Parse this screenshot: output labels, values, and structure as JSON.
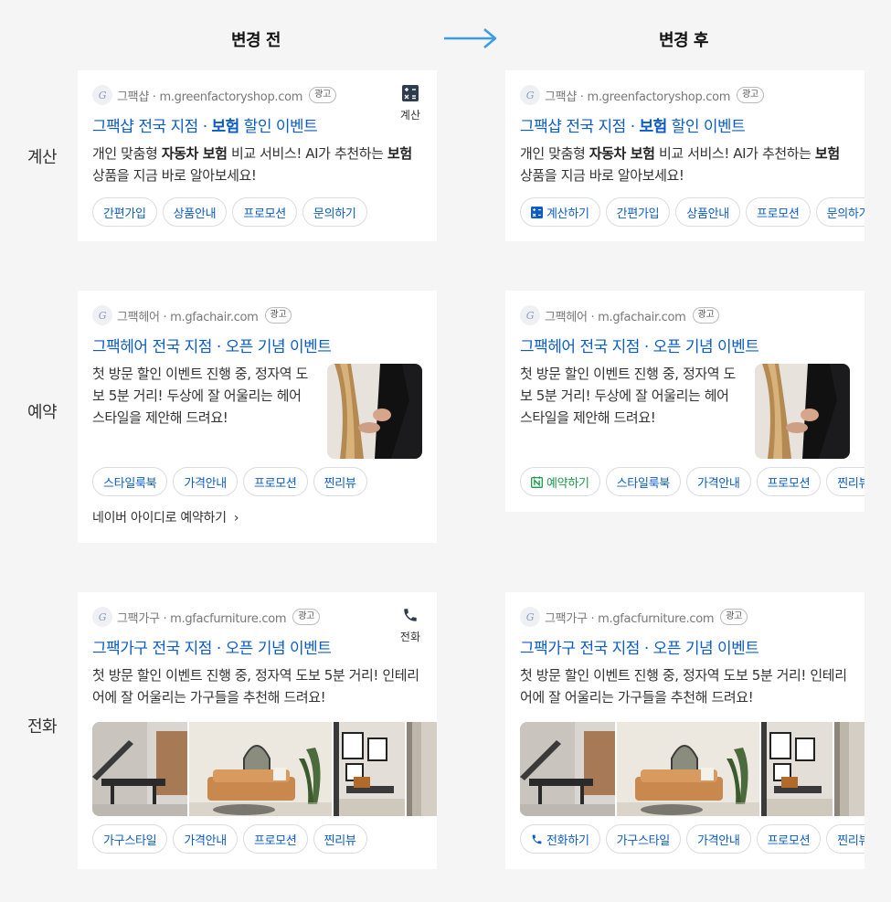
{
  "headers": {
    "before": "변경 전",
    "after": "변경 후"
  },
  "rows": {
    "calc": "계산",
    "reserve": "예약",
    "phone": "전화"
  },
  "ad_badge": "광고",
  "favicon_letter": "G",
  "calc_card": {
    "source": "그팩샵 · m.greenfactoryshop.com",
    "title_pre": "그팩샵 전국 지점 · ",
    "title_bold": "보험",
    "title_post": " 할인 이벤트",
    "desc_1": "개인 맞춤형 ",
    "desc_bold1": "자동차 보험",
    "desc_2": " 비교 서비스! AI가 추천하는 ",
    "desc_bold2": "보험",
    "desc_3": " 상품을 지금 바로 알아보세요!",
    "side_label": "계산",
    "chips_before": [
      "간편가입",
      "상품안내",
      "프로모션",
      "문의하기"
    ],
    "action_chip": "계산하기",
    "chips_after": [
      "간편가입",
      "상품안내",
      "프로모션",
      "문의하기"
    ]
  },
  "reserve_card": {
    "source": "그팩헤어 · m.gfachair.com",
    "title": "그팩헤어 전국 지점 · 오픈 기념 이벤트",
    "desc": "첫 방문 할인 이벤트 진행 중, 정자역 도보 5분 거리! 두상에 잘 어울리는 헤어 스타일을 제안해 드려요!",
    "chips_before": [
      "스타일룩북",
      "가격안내",
      "프로모션",
      "찐리뷰"
    ],
    "naver_link": "네이버 아이디로 예약하기",
    "action_chip": "예약하기",
    "chips_after": [
      "스타일룩북",
      "가격안내",
      "프로모션",
      "찐리뷰"
    ]
  },
  "phone_card": {
    "source": "그팩가구 · m.gfacfurniture.com",
    "title": "그팩가구 전국 지점 · 오픈 기념 이벤트",
    "desc": "첫 방문 할인 이벤트 진행 중, 정자역 도보 5분 거리! 인테리어에 잘 어울리는 가구들을 추천해 드려요!",
    "side_label": "전화",
    "chips_before": [
      "가구스타일",
      "가격안내",
      "프로모션",
      "찐리뷰"
    ],
    "action_chip": "전화하기",
    "chips_after": [
      "가구스타일",
      "가격안내",
      "프로모션",
      "찐리뷰"
    ]
  },
  "colors": {
    "link_blue": "#0c5cc7",
    "reserve_green": "#1a9a4a",
    "arrow_blue": "#3b9be8"
  }
}
